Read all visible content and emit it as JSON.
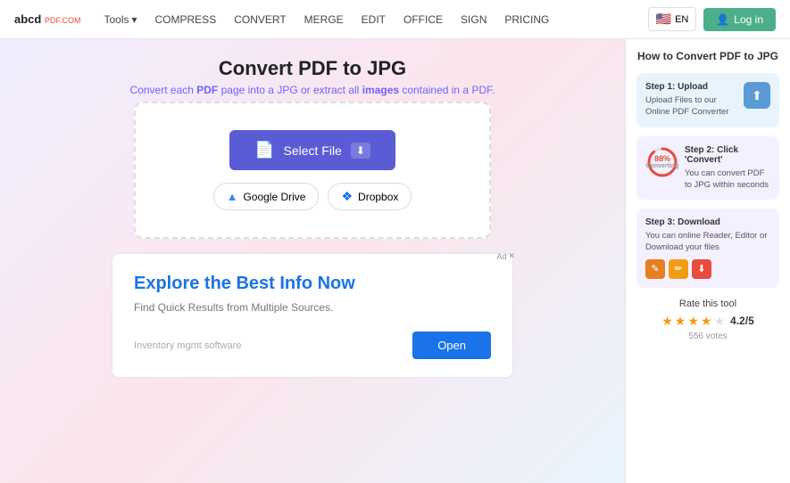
{
  "navbar": {
    "logo_abcd": "abcd",
    "logo_pdf": "PDF.COM",
    "tools_label": "Tools",
    "nav_items": [
      {
        "label": "COMPRESS",
        "active": false
      },
      {
        "label": "CONVERT",
        "active": false
      },
      {
        "label": "MERGE",
        "active": false
      },
      {
        "label": "EDIT",
        "active": false
      },
      {
        "label": "OFFICE",
        "active": false
      },
      {
        "label": "SIGN",
        "active": false
      },
      {
        "label": "PRICING",
        "active": false
      }
    ],
    "lang": "EN",
    "login_label": "Log in"
  },
  "page": {
    "title": "Convert PDF to JPG",
    "subtitle_part1": "Convert each ",
    "subtitle_pdf": "PDF",
    "subtitle_part2": " page into a JPG or extract all ",
    "subtitle_images": "images",
    "subtitle_part3": " contained in a PDF."
  },
  "upload": {
    "select_file_label": "Select File",
    "google_drive_label": "Google Drive",
    "dropbox_label": "Dropbox"
  },
  "ad": {
    "badge": "Ad",
    "close": "✕",
    "title": "Explore the Best Info Now",
    "subtitle": "Find Quick Results from Multiple Sources.",
    "query": "Inventory mgmt software",
    "open_label": "Open"
  },
  "sidebar": {
    "title": "How to Convert PDF to JPG",
    "step1": {
      "label": "Step 1: Upload",
      "desc": "Upload Files to our Online PDF Converter"
    },
    "step2": {
      "label": "Step 2: Click 'Convert'",
      "desc": "You can convert PDF to JPG within seconds",
      "progress": "88",
      "progress_sub": "Converting"
    },
    "step3": {
      "label": "Step 3: Download",
      "desc": "You can online Reader, Editor or Download your files"
    },
    "rating_label": "Rate this tool",
    "rating_score": "4.2/5",
    "rating_votes": "556 votes"
  }
}
